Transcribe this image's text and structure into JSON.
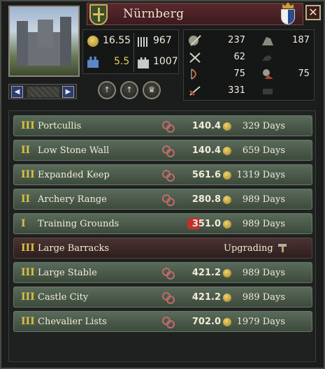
{
  "header": {
    "holding_name": "Nürnberg",
    "close_label": "✕"
  },
  "portrait_nav": {
    "prev_label": "◀",
    "next_label": "▶"
  },
  "stats": {
    "wealth": "16.55",
    "levy_size": "967",
    "fort_level": "5.5",
    "garrison": "1007"
  },
  "actions": [
    {
      "label": "↑"
    },
    {
      "label": "↑"
    },
    {
      "label": "♛"
    }
  ],
  "troops": {
    "light_infantry": "237",
    "light_cavalry": "187",
    "heavy_infantry": "62",
    "pikemen": "75",
    "knights": "75",
    "archers": "331"
  },
  "colors": {
    "row_green": "#4a5b4a",
    "row_upgrading": "#3a2826",
    "tier_gold": "#d8c040"
  },
  "buildings": [
    {
      "tier": "III",
      "name": "Portcullis",
      "cost": "140.4",
      "days": "329 Days",
      "status": ""
    },
    {
      "tier": "II",
      "name": "Low Stone Wall",
      "cost": "140.4",
      "days": "659 Days",
      "status": ""
    },
    {
      "tier": "III",
      "name": "Expanded Keep",
      "cost": "561.6",
      "days": "1319 Days",
      "status": ""
    },
    {
      "tier": "II",
      "name": "Archery Range",
      "cost": "280.8",
      "days": "989 Days",
      "status": ""
    },
    {
      "tier": "I",
      "name": "Training Grounds",
      "cost": "351.0",
      "days": "989 Days",
      "status": ""
    },
    {
      "tier": "III",
      "name": "Large Barracks",
      "cost": "",
      "days": "",
      "status": "Upgrading"
    },
    {
      "tier": "III",
      "name": "Large Stable",
      "cost": "421.2",
      "days": "989 Days",
      "status": ""
    },
    {
      "tier": "III",
      "name": "Castle City",
      "cost": "421.2",
      "days": "989 Days",
      "status": ""
    },
    {
      "tier": "III",
      "name": "Chevalier Lists",
      "cost": "702.0",
      "days": "1979 Days",
      "status": ""
    }
  ]
}
